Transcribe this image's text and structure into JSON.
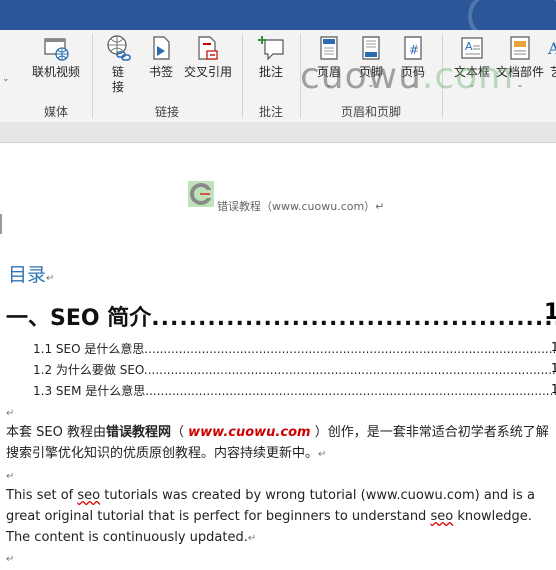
{
  "ribbon": {
    "groups": [
      {
        "label": "媒体",
        "buttons": [
          {
            "label": "联机视频",
            "icon": "online-video-icon"
          }
        ]
      },
      {
        "label": "链接",
        "buttons": [
          {
            "label": "链\n接",
            "icon": "link-icon"
          },
          {
            "label": "书签",
            "icon": "bookmark-icon"
          },
          {
            "label": "交叉引用",
            "icon": "cross-reference-icon"
          }
        ]
      },
      {
        "label": "批注",
        "buttons": [
          {
            "label": "批注",
            "icon": "comment-icon"
          }
        ]
      },
      {
        "label": "页眉和页脚",
        "buttons": [
          {
            "label": "页眉",
            "icon": "header-icon"
          },
          {
            "label": "页脚",
            "icon": "footer-icon"
          },
          {
            "label": "页码",
            "icon": "page-number-icon"
          }
        ]
      },
      {
        "label": "",
        "buttons": [
          {
            "label": "文本框",
            "icon": "text-box-icon"
          },
          {
            "label": "文档部件",
            "icon": "quick-parts-icon"
          },
          {
            "label": "艺",
            "icon": "wordart-icon"
          }
        ]
      }
    ],
    "dropdown_arrow": "⌄"
  },
  "watermark": {
    "text": "cuowu",
    "suffix": ".com"
  },
  "document": {
    "header_text": "错误教程（www.cuowu.com）↵",
    "toc_title": "目录",
    "toc_entries": [
      {
        "text": "一、SEO 简介",
        "page": "1"
      },
      {
        "text": "1.1 SEO 是什么意思",
        "page": "1"
      },
      {
        "text": "1.2  为什么要做 SEO",
        "page": "1"
      },
      {
        "text": "1.3 SEM 是什么意思",
        "page": "1"
      }
    ],
    "para_cn_prefix": "本套 SEO 教程由",
    "para_cn_bold": "错误教程网",
    "para_cn_open": "（",
    "para_cn_link": "www.cuowu.com",
    "para_cn_rest": "）创作，是一套非常适合初学者系统了解搜索引擎优化知识的优质原创教程。内容持续更新中。",
    "para_en_1": "This set of ",
    "para_en_seo": "seo",
    "para_en_2": " tutorials was created by wrong tutorial (www.cuowu.com) and is a great original tutorial that is perfect for beginners to understand ",
    "para_en_seo2": "seo",
    "para_en_3": " knowledge. The content is continuously updated.",
    "para_mark": "↵"
  }
}
